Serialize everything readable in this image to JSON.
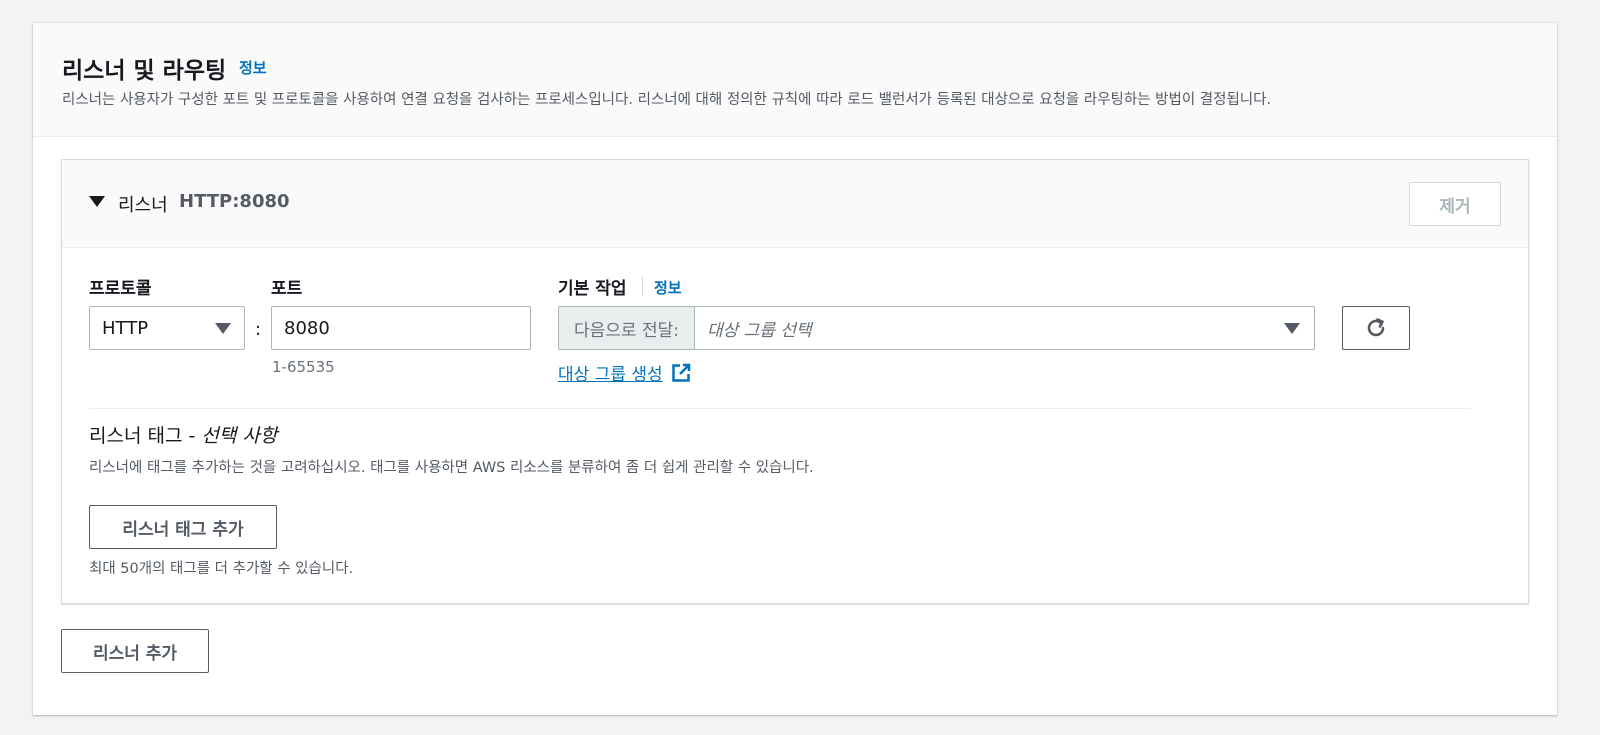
{
  "section": {
    "title": "리스너 및 라우팅",
    "info": "정보",
    "description": "리스너는 사용자가 구성한 포트 및 프로토콜을 사용하여 연결 요청을 검사하는 프로세스입니다. 리스너에 대해 정의한 규칙에 따라 로드 밸런서가 등록된 대상으로 요청을 라우팅하는 방법이 결정됩니다."
  },
  "listener": {
    "label": "리스너",
    "name": "HTTP:8080",
    "remove_label": "제거",
    "protocol_label": "프로토콜",
    "protocol_value": "HTTP",
    "port_label": "포트",
    "port_separator": ":",
    "port_value": "8080",
    "port_hint": "1-65535",
    "default_action_label": "기본 작업",
    "default_action_info": "정보",
    "forward_prefix": "다음으로 전달:",
    "target_placeholder": "대상 그룹 선택",
    "create_target_link": "대상 그룹 생성"
  },
  "tags": {
    "title": "리스너 태그 - ",
    "title_optional": "선택 사항",
    "description": "리스너에 태그를 추가하는 것을 고려하십시오. 태그를 사용하면 AWS 리소스를 분류하여 좀 더 쉽게 관리할 수 있습니다.",
    "add_button": "리스너 태그 추가",
    "limit_text": "최대 50개의 태그를 더 추가할 수 있습니다."
  },
  "add_listener_button": "리스너 추가",
  "colors": {
    "link": "#0073bb",
    "text": "#16191f",
    "muted": "#545b64",
    "disabled": "#aab7b8"
  },
  "icons": {
    "caret": "caret-down-icon",
    "select_arrow": "chevron-down-icon",
    "refresh": "refresh-icon",
    "external": "external-link-icon"
  }
}
